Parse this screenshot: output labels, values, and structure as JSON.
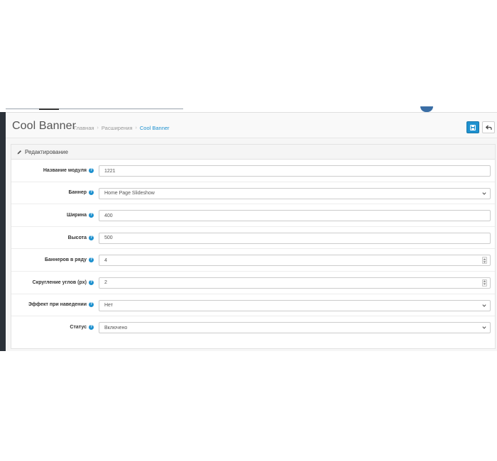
{
  "header": {
    "title": "Cool Banner",
    "breadcrumb": [
      "Главная",
      "Расширения",
      "Cool Banner"
    ]
  },
  "actions": {
    "save_icon": "save-icon",
    "back_icon": "back-arrow-icon"
  },
  "panel": {
    "heading": "Редактирование",
    "heading_icon": "pencil-icon"
  },
  "form": {
    "fields": [
      {
        "label": "Название модуля",
        "value": "1221",
        "type": "text"
      },
      {
        "label": "Баннер",
        "value": "Home Page Slideshow",
        "type": "select"
      },
      {
        "label": "Ширина",
        "value": "400",
        "type": "text"
      },
      {
        "label": "Высота",
        "value": "500",
        "type": "text"
      },
      {
        "label": "Баннеров в ряду",
        "value": "4",
        "type": "number"
      },
      {
        "label": "Скругление углов (px)",
        "value": "2",
        "type": "number"
      },
      {
        "label": "Эффект при наведении",
        "value": "Нет",
        "type": "select"
      },
      {
        "label": "Статус",
        "value": "Включено",
        "type": "select"
      }
    ],
    "help_glyph": "?"
  },
  "colors": {
    "accent": "#1e91cf",
    "sidebar": "#2b3139"
  }
}
